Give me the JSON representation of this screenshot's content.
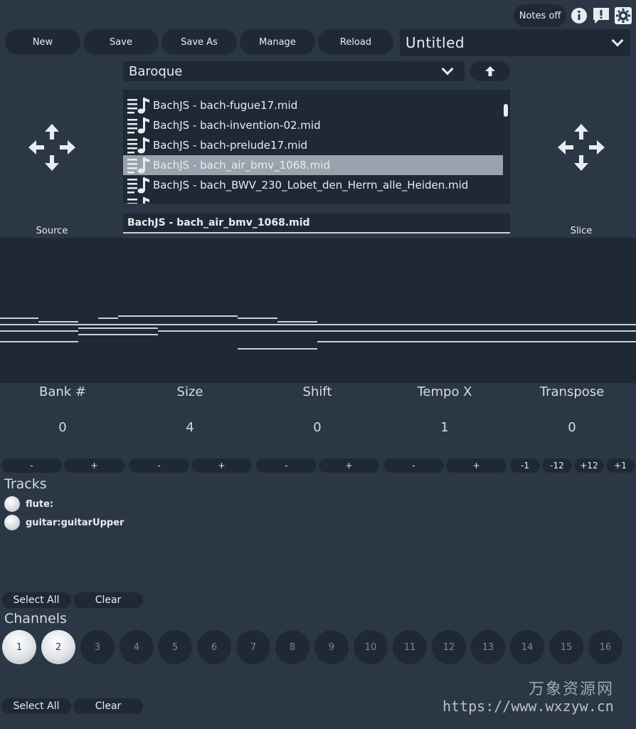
{
  "header": {
    "notes_toggle": "Notes off"
  },
  "toolbar": {
    "buttons": [
      "New",
      "Save",
      "Save As",
      "Manage",
      "Reload"
    ],
    "preset_name": "Untitled"
  },
  "browser": {
    "folder": "Baroque",
    "files": [
      "BachJS - bach-fugue17.mid",
      "BachJS - bach-invention-02.mid",
      "BachJS - bach-prelude17.mid",
      "BachJS - bach_air_bmv_1068.mid",
      "BachJS - bach_BWV_230_Lobet_den_Herrn_alle_Heiden.mid"
    ],
    "selected_index": 3,
    "selected_file": "BachJS - bach_air_bmv_1068.mid"
  },
  "drag": {
    "source_label": "Source",
    "slice_label": "Slice"
  },
  "params": [
    {
      "label": "Bank #",
      "value": "0"
    },
    {
      "label": "Size",
      "value": "4"
    },
    {
      "label": "Shift",
      "value": "0"
    },
    {
      "label": "Tempo X",
      "value": "1"
    },
    {
      "label": "Transpose",
      "value": "0"
    }
  ],
  "stepper": {
    "minus": "-",
    "plus": "+"
  },
  "transpose_buttons": [
    "-1",
    "-12",
    "+12",
    "+1"
  ],
  "tracks": {
    "title": "Tracks",
    "items": [
      "flute:",
      "guitar:guitarUpper"
    ],
    "select_all": "Select All",
    "clear": "Clear"
  },
  "channels": {
    "title": "Channels",
    "items": [
      "1",
      "2",
      "3",
      "4",
      "5",
      "6",
      "7",
      "8",
      "9",
      "10",
      "11",
      "12",
      "13",
      "14",
      "15",
      "16"
    ],
    "active": [
      1,
      2
    ],
    "select_all": "Select All",
    "clear": "Clear"
  },
  "watermark": {
    "cn": "万象资源网",
    "url": "https://www.wxzyw.cn"
  },
  "colors": {
    "background": "#2b3745",
    "control": "#1f2935",
    "text": "#e7ecf1",
    "selection": "#9aa3ad"
  }
}
